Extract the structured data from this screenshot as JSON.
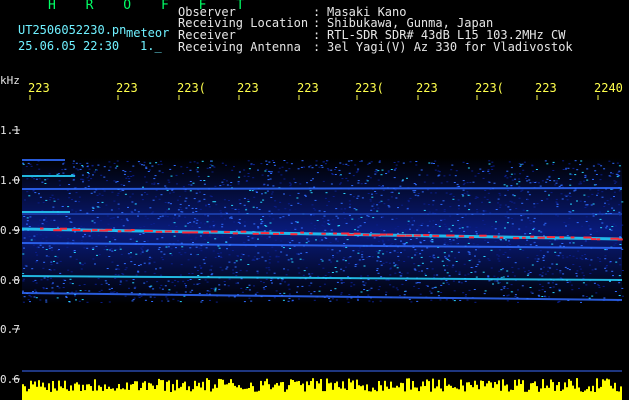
{
  "header": {
    "brand": "H R O F F T",
    "file_name": "UT2506052230.pn",
    "mode": "meteor",
    "datetime": "25.06.05 22:30",
    "index": "1._",
    "rows": [
      {
        "label": "Observer",
        "value": "Masaki Kano"
      },
      {
        "label": "Receiving Location",
        "value": "Shibukawa, Gunma, Japan"
      },
      {
        "label": "Receiver",
        "value": "RTL-SDR SDR# 43dB L15 103.2MHz CW"
      },
      {
        "label": "Receiving Antenna",
        "value": "3el Yagi(V) Az 330 for Vladivostok"
      }
    ]
  },
  "axis": {
    "unit": "kHz",
    "time_labels": [
      "223",
      "223",
      "223(",
      "223",
      "223",
      "223(",
      "223",
      "223(",
      "223",
      "2240"
    ],
    "freq_labels": [
      "1.1",
      "1.0",
      "0.9",
      "0.8",
      "0.7",
      "0.6"
    ]
  },
  "colors": {
    "background": "#000000",
    "noise": "#0a1e8a",
    "weak": "#2f6bff",
    "medium": "#27d6ff",
    "strong": "#ff2a3a",
    "bar": "#ffff00",
    "tick": "#ffff4c",
    "header_text": "#e6e6e6",
    "brand": "#00ff66",
    "meta_text": "#6ff0ff"
  }
}
